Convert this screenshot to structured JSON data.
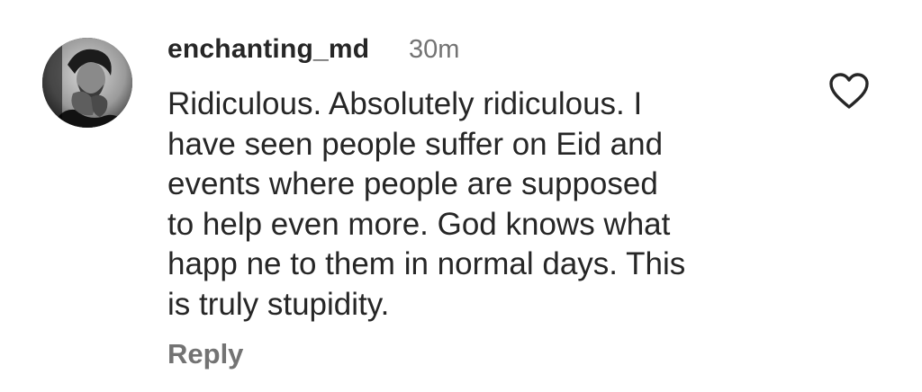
{
  "comment": {
    "username": "enchanting_md",
    "timestamp": "30m",
    "text": "Ridiculous. Absolutely ridiculous. I\nhave seen people suffer on Eid and\nevents where people are supposed\nto help even more. God knows what\nhapp ne to them in normal days. This\nis truly stupidity.",
    "reply_label": "Reply",
    "avatar_icon": "user-avatar-photo",
    "like_icon": "heart-outline-icon"
  },
  "colors": {
    "text_primary": "#262626",
    "text_secondary": "#737373",
    "background": "#ffffff"
  }
}
